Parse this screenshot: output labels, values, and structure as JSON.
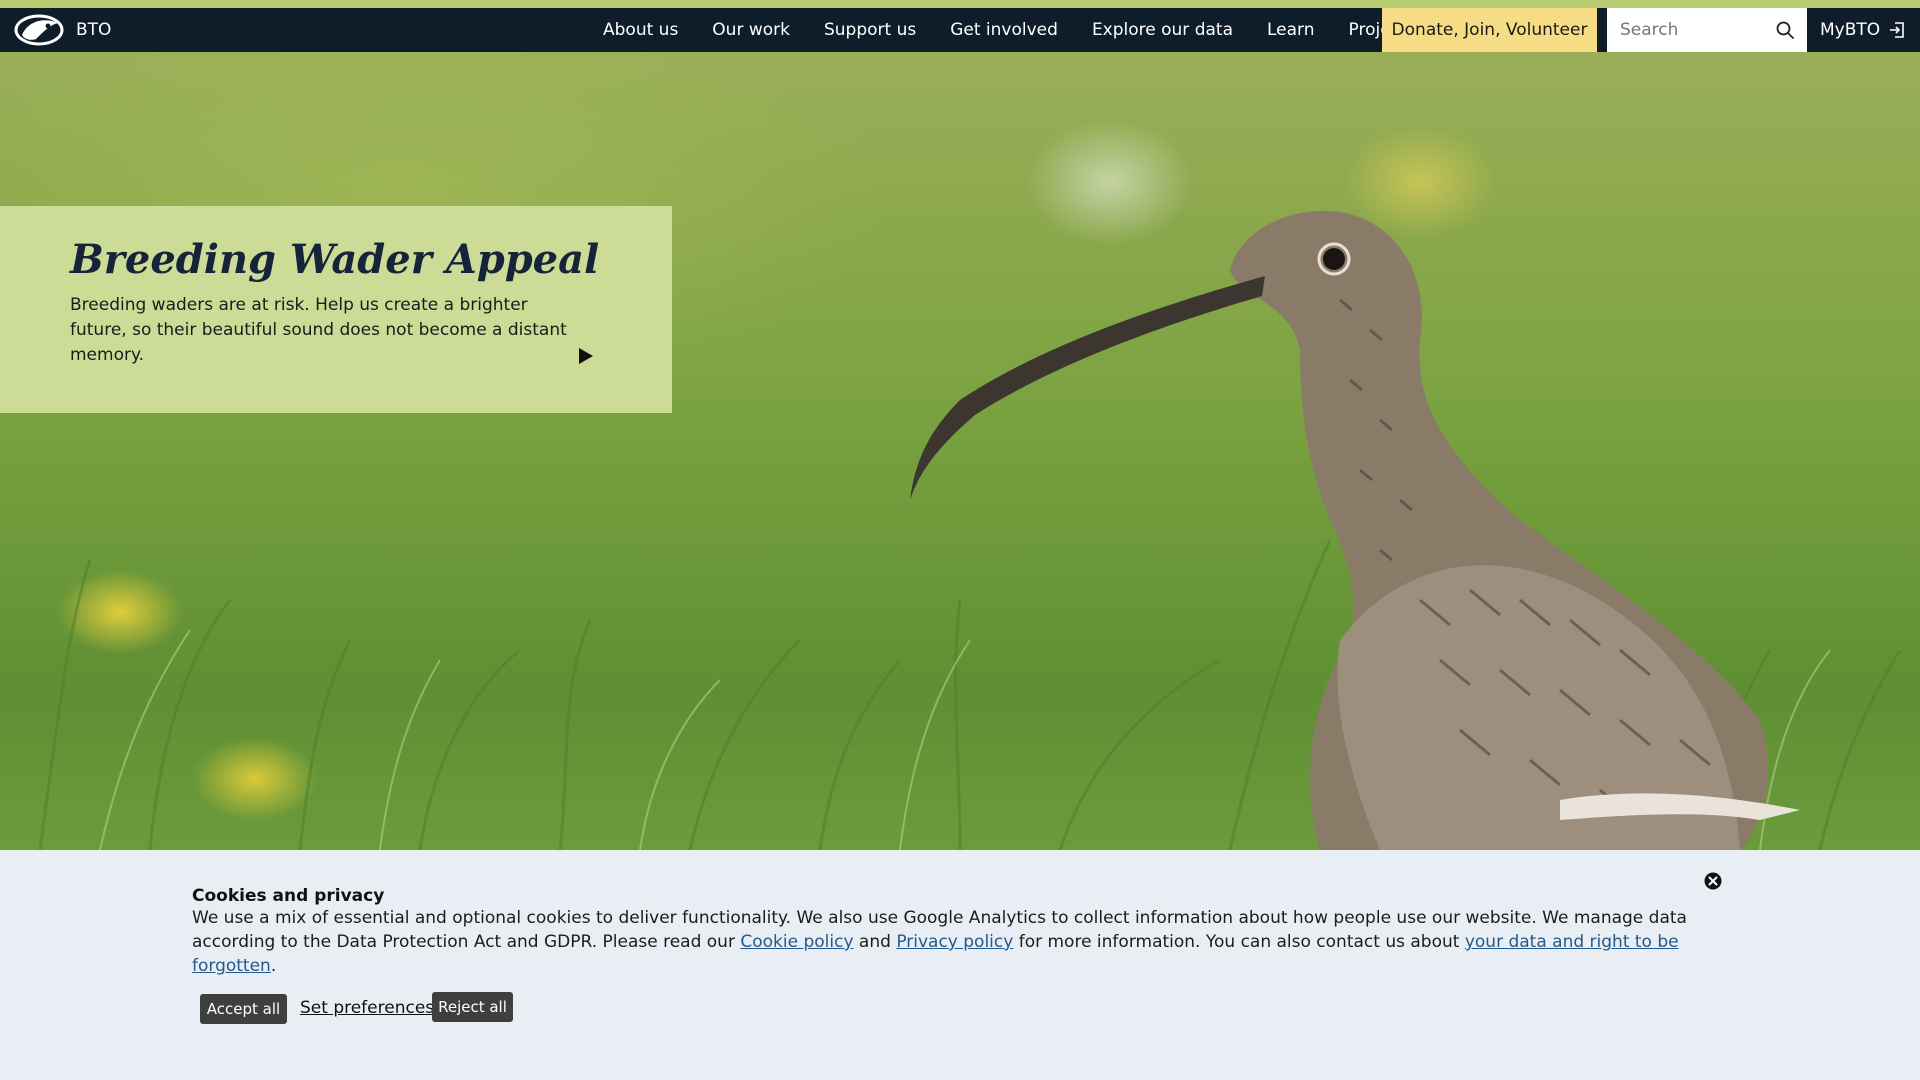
{
  "header": {
    "logo_text": "BTO",
    "nav": [
      "About us",
      "Our work",
      "Support us",
      "Get involved",
      "Explore our data",
      "Learn",
      "Projects"
    ],
    "cta_label": "Donate, Join, Volunteer",
    "search_placeholder": "Search",
    "account_label": "MyBTO"
  },
  "hero": {
    "title": "Breeding Wader Appeal",
    "text": "Breeding waders are at risk. Help us create a brighter future, so their beautiful sound does not become a distant memory."
  },
  "cookie_banner": {
    "title": "Cookies and privacy",
    "text_part1": "We use a mix of essential and optional cookies to deliver functionality. We also use Google Analytics to collect information about how people use our website. We manage data according to the Data Protection Act and GDPR. Please read our ",
    "cookie_policy_link": "Cookie policy",
    "text_part2": " and ",
    "privacy_policy_link": "Privacy policy",
    "text_part3": " for more information. You can also contact us about ",
    "forgotten_link": "your data and right to be forgotten",
    "text_part4": ".",
    "accept_label": "Accept all",
    "preferences_label": "Set preferences",
    "reject_label": "Reject all"
  },
  "colors": {
    "nav_background": "#0f1d2a",
    "top_accent": "#b7cb6f",
    "cta_background": "#f6dc85",
    "appeal_panel": "#ccdb95",
    "cookie_background": "#e9eef5",
    "link": "#235a8c"
  },
  "icons": {
    "logo": "bto-bird-logo",
    "search": "search-icon",
    "account": "sign-in-icon",
    "close": "close-icon",
    "arrow": "play-arrow-icon"
  }
}
